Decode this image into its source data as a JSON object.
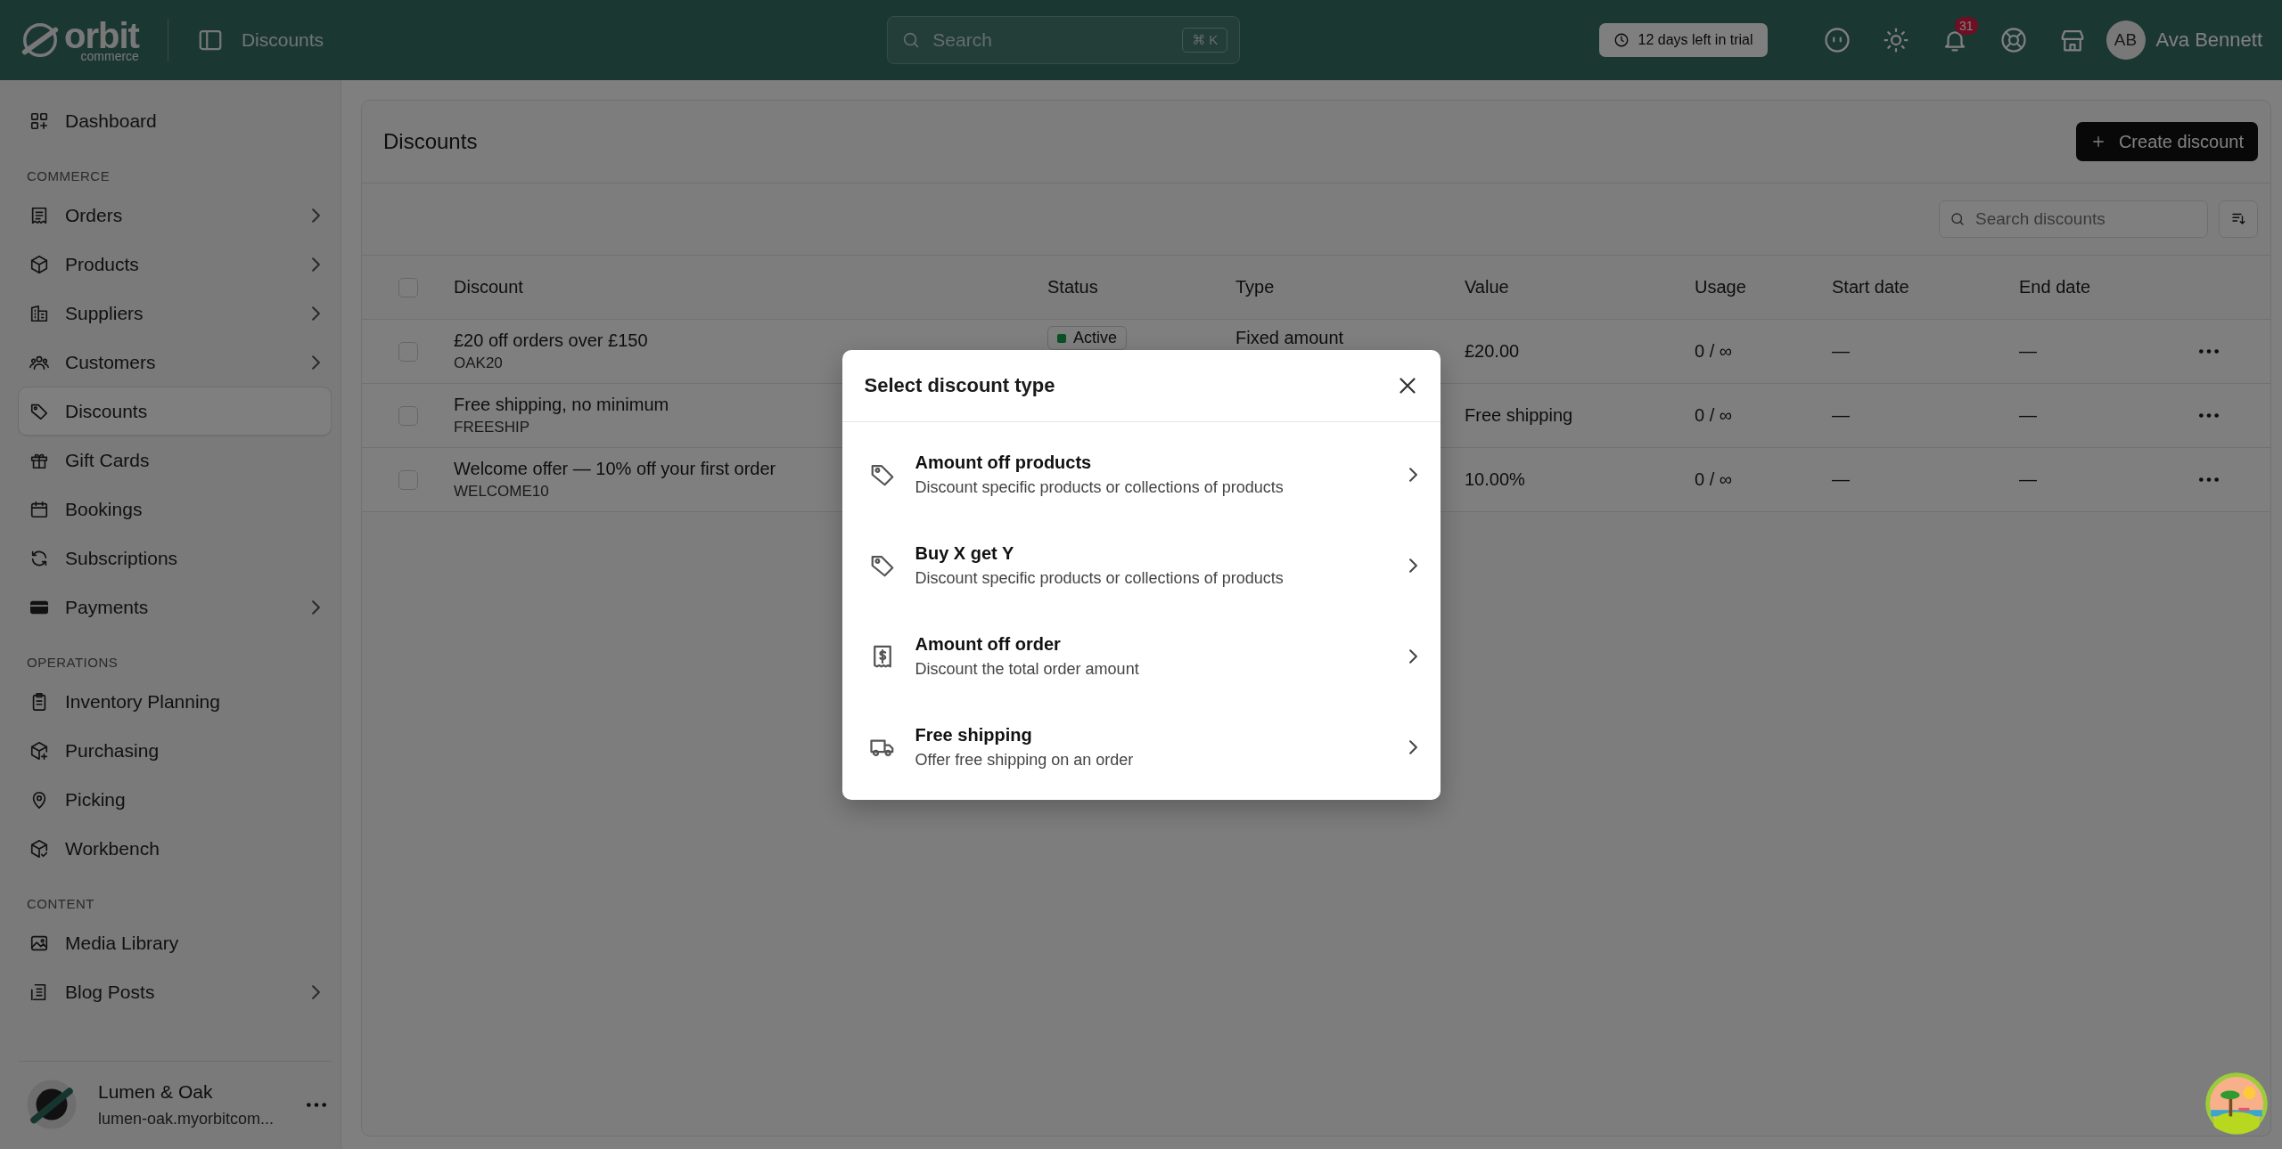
{
  "topbar": {
    "logo": {
      "name": "orbit",
      "sub": "commerce"
    },
    "page_title": "Discounts",
    "search": {
      "placeholder": "Search",
      "shortcut": "⌘ K"
    },
    "trial_badge": "12 days left in trial",
    "notifications": "31",
    "user": {
      "initials": "AB",
      "name": "Ava Bennett"
    }
  },
  "sidebar": {
    "sections": [
      {
        "items": [
          {
            "label": "Dashboard",
            "has_children": false,
            "selected": false
          }
        ]
      },
      {
        "heading": "COMMERCE",
        "items": [
          {
            "label": "Orders",
            "has_children": true,
            "selected": false
          },
          {
            "label": "Products",
            "has_children": true,
            "selected": false
          },
          {
            "label": "Suppliers",
            "has_children": true,
            "selected": false
          },
          {
            "label": "Customers",
            "has_children": true,
            "selected": false
          },
          {
            "label": "Discounts",
            "has_children": false,
            "selected": true
          },
          {
            "label": "Gift Cards",
            "has_children": false,
            "selected": false
          },
          {
            "label": "Bookings",
            "has_children": false,
            "selected": false
          },
          {
            "label": "Subscriptions",
            "has_children": false,
            "selected": false
          },
          {
            "label": "Payments",
            "has_children": true,
            "selected": false
          }
        ]
      },
      {
        "heading": "OPERATIONS",
        "items": [
          {
            "label": "Inventory Planning",
            "has_children": false,
            "selected": false
          },
          {
            "label": "Purchasing",
            "has_children": false,
            "selected": false
          },
          {
            "label": "Picking",
            "has_children": false,
            "selected": false
          },
          {
            "label": "Workbench",
            "has_children": false,
            "selected": false
          }
        ]
      },
      {
        "heading": "CONTENT",
        "items": [
          {
            "label": "Media Library",
            "has_children": false,
            "selected": false
          },
          {
            "label": "Blog Posts",
            "has_children": true,
            "selected": false
          }
        ]
      }
    ],
    "store": {
      "name": "Lumen & Oak",
      "domain": "lumen-oak.myorbitcom..."
    }
  },
  "main": {
    "title": "Discounts",
    "create_button": "Create discount",
    "search": {
      "placeholder": "Search discounts"
    },
    "table": {
      "all_selected": false,
      "columns": [
        "Discount",
        "Status",
        "Type",
        "Value",
        "Usage",
        "Start date",
        "End date"
      ],
      "rows": [
        {
          "name": "£20 off orders over £150",
          "code": "OAK20",
          "status": "Active",
          "type": "Fixed amount",
          "value": "£20.00",
          "usage": "0 / ∞",
          "start": "—",
          "end": "—",
          "checked": false
        },
        {
          "name": "Free shipping, no minimum",
          "code": "FREESHIP",
          "value": "Free shipping",
          "usage": "0 / ∞",
          "start": "—",
          "end": "—",
          "checked": false
        },
        {
          "name": "Welcome offer — 10% off your first order",
          "code": "WELCOME10",
          "value": "10.00%",
          "usage": "0 / ∞",
          "start": "—",
          "end": "—",
          "checked": false
        }
      ]
    }
  },
  "dialog": {
    "title": "Select discount type",
    "options": [
      {
        "kind": "tag",
        "title": "Amount off products",
        "description": "Discount specific products or collections of products"
      },
      {
        "kind": "tag",
        "title": "Buy X get Y",
        "description": "Discount specific products or collections of products"
      },
      {
        "kind": "receipt",
        "title": "Amount off order",
        "description": "Discount the total order amount"
      },
      {
        "kind": "truck",
        "title": "Free shipping",
        "description": "Offer free shipping on an order"
      }
    ]
  }
}
